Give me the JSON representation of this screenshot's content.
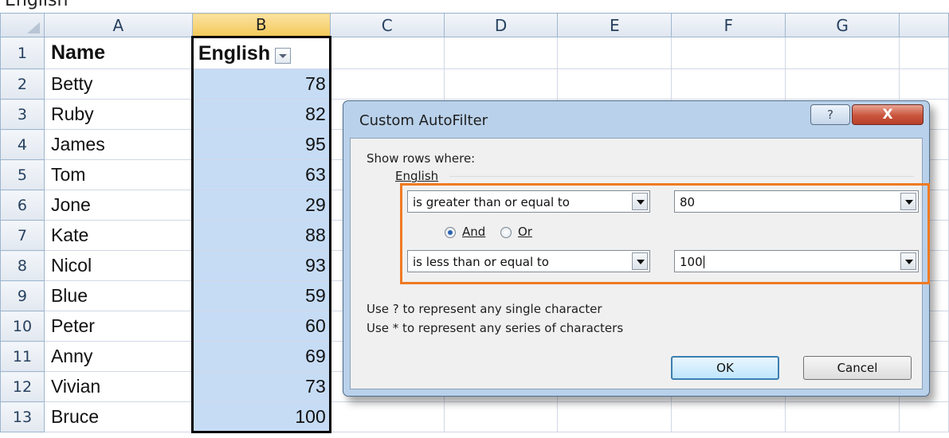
{
  "top_strip_text": "English",
  "sheet": {
    "columns": [
      "A",
      "B",
      "C",
      "D",
      "E",
      "F",
      "G"
    ],
    "header_row": {
      "row": "1",
      "name": "Name",
      "score": "English"
    },
    "rows": [
      {
        "row": "2",
        "name": "Betty",
        "score": "78"
      },
      {
        "row": "3",
        "name": "Ruby",
        "score": "82"
      },
      {
        "row": "4",
        "name": "James",
        "score": "95"
      },
      {
        "row": "5",
        "name": "Tom",
        "score": "63"
      },
      {
        "row": "6",
        "name": "Jone",
        "score": "29"
      },
      {
        "row": "7",
        "name": "Kate",
        "score": "88"
      },
      {
        "row": "8",
        "name": "Nicol",
        "score": "93"
      },
      {
        "row": "9",
        "name": "Blue",
        "score": "59"
      },
      {
        "row": "10",
        "name": "Peter",
        "score": "60"
      },
      {
        "row": "11",
        "name": "Anny",
        "score": "69"
      },
      {
        "row": "12",
        "name": "Vivian",
        "score": "73"
      },
      {
        "row": "13",
        "name": "Bruce",
        "score": "100"
      }
    ]
  },
  "dialog": {
    "title": "Custom AutoFilter",
    "help_label": "?",
    "close_label": "X",
    "show_rows_label": "Show rows where:",
    "field_label": "English",
    "condition1": {
      "operator": "is greater than or equal to",
      "value": "80"
    },
    "logic": {
      "and_label": "And",
      "or_label": "Or",
      "selected": "And"
    },
    "condition2": {
      "operator": "is less than or equal to",
      "value": "100"
    },
    "hint1": "Use ? to represent any single character",
    "hint2": "Use * to represent any series of characters",
    "ok_label": "OK",
    "cancel_label": "Cancel"
  },
  "colors": {
    "selection_fill": "#c6dcf5",
    "selected_header": "#f3c85a",
    "highlight_border": "#f07a22",
    "dialog_frame": "#b9d1ea",
    "close_button": "#c9553c"
  }
}
